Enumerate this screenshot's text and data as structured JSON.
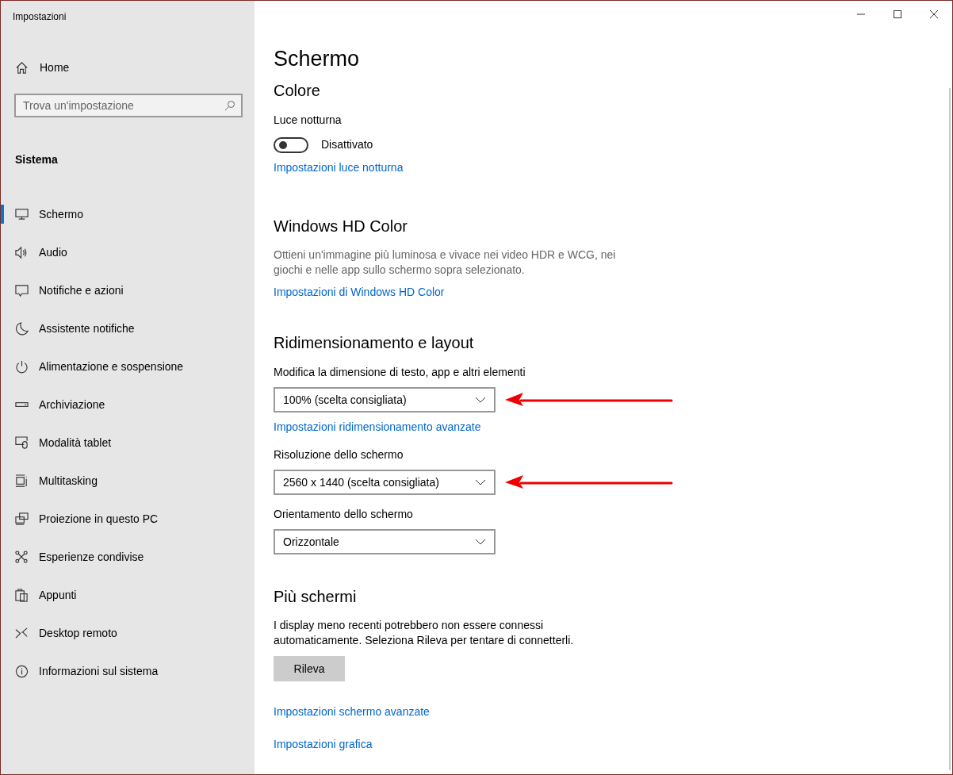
{
  "window": {
    "title": "Impostazioni"
  },
  "sidebar": {
    "home": "Home",
    "search": {
      "placeholder": "Trova un'impostazione"
    },
    "section": "Sistema",
    "items": [
      {
        "label": "Schermo",
        "selected": true
      },
      {
        "label": "Audio",
        "selected": false
      },
      {
        "label": "Notifiche e azioni",
        "selected": false
      },
      {
        "label": "Assistente notifiche",
        "selected": false
      },
      {
        "label": "Alimentazione e sospensione",
        "selected": false
      },
      {
        "label": "Archiviazione",
        "selected": false
      },
      {
        "label": "Modalità tablet",
        "selected": false
      },
      {
        "label": "Multitasking",
        "selected": false
      },
      {
        "label": "Proiezione in questo PC",
        "selected": false
      },
      {
        "label": "Esperienze condivise",
        "selected": false
      },
      {
        "label": "Appunti",
        "selected": false
      },
      {
        "label": "Desktop remoto",
        "selected": false
      },
      {
        "label": "Informazioni sul sistema",
        "selected": false
      }
    ]
  },
  "main": {
    "title": "Schermo",
    "sections": [
      {
        "heading": "Colore",
        "blocks": [
          {
            "kind": "label",
            "text": "Luce notturna"
          },
          {
            "kind": "toggle",
            "on": false,
            "text": "Disattivato"
          },
          {
            "kind": "link",
            "text": "Impostazioni luce notturna"
          }
        ]
      },
      {
        "heading": "Windows HD Color",
        "blocks": [
          {
            "kind": "note",
            "text": "Ottieni un'immagine più luminosa e vivace nei video HDR e WCG, nei giochi e nelle app sullo schermo sopra selezionato."
          },
          {
            "kind": "link",
            "text": "Impostazioni di Windows HD Color"
          }
        ]
      },
      {
        "heading": "Ridimensionamento e layout",
        "blocks": [
          {
            "kind": "label",
            "text": "Modifica la dimensione di testo, app e altri elementi"
          },
          {
            "kind": "dropdown",
            "value": "100% (scelta consigliata)",
            "arrow": true
          },
          {
            "kind": "link",
            "text": "Impostazioni ridimensionamento avanzate"
          },
          {
            "kind": "label",
            "text": "Risoluzione dello schermo"
          },
          {
            "kind": "dropdown",
            "value": "2560 x 1440 (scelta consigliata)",
            "arrow": true
          },
          {
            "kind": "label",
            "text": "Orientamento dello schermo"
          },
          {
            "kind": "dropdown",
            "value": "Orizzontale",
            "arrow": false
          }
        ]
      },
      {
        "heading": "Più schermi",
        "blocks": [
          {
            "kind": "text",
            "text": "I display meno recenti potrebbero non essere connessi automaticamente. Seleziona Rileva per tentare di connetterli."
          },
          {
            "kind": "button",
            "text": "Rileva"
          },
          {
            "kind": "link",
            "text": "Impostazioni schermo avanzate"
          },
          {
            "kind": "link",
            "text": "Impostazioni grafica"
          }
        ]
      }
    ]
  }
}
